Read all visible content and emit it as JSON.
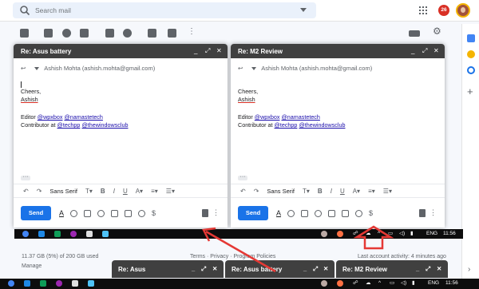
{
  "search": {
    "placeholder": "Search mail"
  },
  "notifications": {
    "count": "26"
  },
  "colors": {
    "accent": "#1a73e8",
    "compose_header": "#404040",
    "annotation": "#e53935"
  },
  "compose_windows": [
    {
      "title": "Re: Asus battery",
      "from": "Ashish Mohta (ashish.mohta@gmail.com)",
      "body": {
        "closing": "Cheers,",
        "name": "Ashish",
        "editor_prefix": "Editor",
        "editor_links": [
          "@wpxbox",
          "@namastetech"
        ],
        "contributor_prefix": "Contributor at",
        "contributor_links": [
          "@techpp",
          "@thewindowsclub"
        ]
      },
      "font": "Sans Serif",
      "send_label": "Send"
    },
    {
      "title": "Re: M2 Review",
      "from": "Ashish Mohta (ashish.mohta@gmail.com)",
      "body": {
        "closing": "Cheers,",
        "name": "Ashish",
        "editor_prefix": "Editor",
        "editor_links": [
          "@wpxbox",
          "@namastetech"
        ],
        "contributor_prefix": "Contributor at",
        "contributor_links": [
          "@techpp",
          "@thewindowsclub"
        ]
      },
      "font": "Sans Serif",
      "send_label": "Send"
    }
  ],
  "taskbar": {
    "language": "ENG",
    "time": "11:56"
  },
  "footer": {
    "storage": "11.37 GB (5%) of 200 GB used",
    "manage": "Manage",
    "terms": "Terms · Privacy · Program Policies",
    "last_activity": "Last account activity: 4 minutes ago"
  },
  "minimized": [
    {
      "title": "Re: Asus"
    },
    {
      "title": "Re: Asus battery"
    },
    {
      "title": "Re: M2 Review"
    }
  ]
}
